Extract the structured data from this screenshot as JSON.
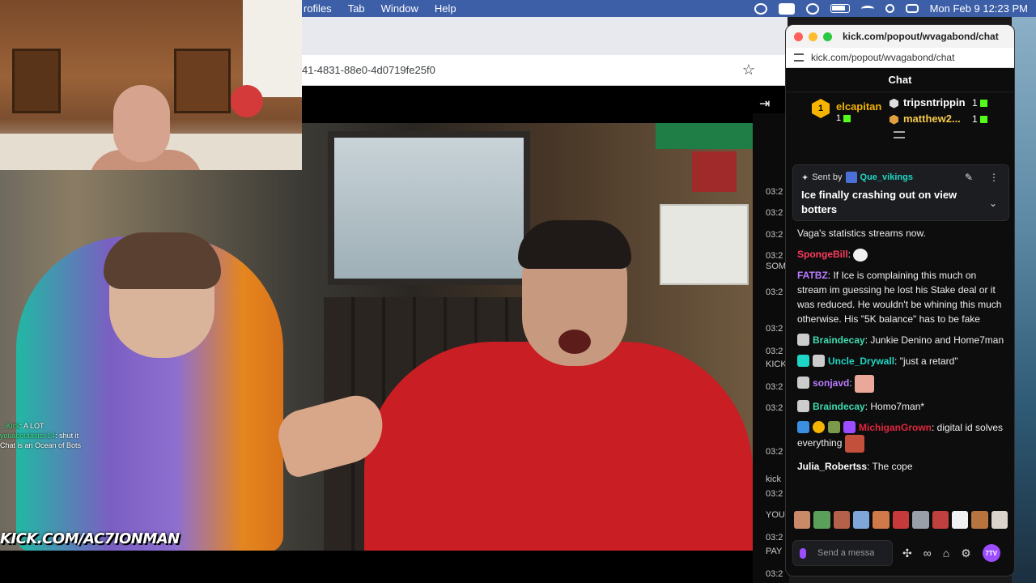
{
  "menubar": {
    "items": [
      "rofiles",
      "Tab",
      "Window",
      "Help"
    ],
    "clock": "Mon Feb 9  12:23 PM"
  },
  "browser": {
    "url_fragment": "41-4831-88e0-4d0719fe25f0"
  },
  "stream": {
    "watermark": "KICK.COM/AC7IONMAN",
    "overlay_chat": [
      {
        "user": "...Kick",
        "text": ": A LOT"
      },
      {
        "user": "youaboutasize14",
        "text": ": shut it"
      },
      {
        "user": "",
        "text": "Chat is an Ocean of Bots"
      }
    ]
  },
  "behind_log": {
    "rows": [
      {
        "time": "03:2",
        "extra": ""
      },
      {
        "time": "03:2",
        "extra": ""
      },
      {
        "time": "03:2",
        "extra": ""
      },
      {
        "time": "03:2",
        "extra": "SOM"
      },
      {
        "time": "03:2",
        "extra": ""
      },
      {
        "time": "03:2",
        "extra": ""
      },
      {
        "time": "03:2",
        "extra": "KICK"
      },
      {
        "time": "03:2",
        "extra": ""
      },
      {
        "time": "03:2",
        "extra": ""
      },
      {
        "time": "03:2",
        "extra": "kick"
      },
      {
        "time": "03:2",
        "extra": "YOU"
      },
      {
        "time": "03:2",
        "extra": "PAY"
      },
      {
        "time": "03:2",
        "extra": ""
      }
    ]
  },
  "popout": {
    "window_title": "kick.com/popout/wvagabond/chat",
    "url": "kick.com/popout/wvagabond/chat",
    "chat_title": "Chat",
    "leaderboard": {
      "first": {
        "rank": "1",
        "name": "elcapitan",
        "count": "1"
      },
      "others": [
        {
          "name": "tripsntrippin",
          "count": "1",
          "color": "#ffffff"
        },
        {
          "name": "matthew2...",
          "count": "1",
          "color": "#f7c948"
        }
      ]
    },
    "pinned": {
      "sent_by_label": "Sent by",
      "user": "Que_vikings",
      "message": "Ice finally crashing out on view botters"
    },
    "messages": [
      {
        "user": "",
        "user_color": "#ffffff",
        "text": "Vaga's statistics streams now."
      },
      {
        "user": "SpongeBill",
        "user_color": "#ff3b5c",
        "text": ":"
      },
      {
        "user": "FATBZ",
        "user_color": "#b97cff",
        "text": ": If Ice is complaining this much on stream im guessing he lost his Stake deal or it was reduced. He wouldn't be whining this much otherwise. His \"5K balance\" has to be fake"
      },
      {
        "user": "Braindecay",
        "user_color": "#3ddcae",
        "text": ": Junkie Denino and Home7man"
      },
      {
        "user": "Uncle_Drywall",
        "user_color": "#1ed6c5",
        "text": ": \"just a retard\""
      },
      {
        "user": "sonjavd",
        "user_color": "#b97cff",
        "text": ":"
      },
      {
        "user": "Braindecay",
        "user_color": "#3ddcae",
        "text": ": Homo7man*"
      },
      {
        "user": "MichiganGrown",
        "user_color": "#e0263d",
        "text": ": digital id solves everything"
      },
      {
        "user": "Julia_Robertss",
        "user_color": "#ffffff",
        "text": ": The cope"
      }
    ],
    "composer": {
      "placeholder": "Send a message",
      "seventv_label": "7TV"
    }
  },
  "colors": {
    "kick_green": "#53fc18",
    "menubar_blue": "#3d5fa8",
    "accent_purple": "#9b4dff"
  }
}
